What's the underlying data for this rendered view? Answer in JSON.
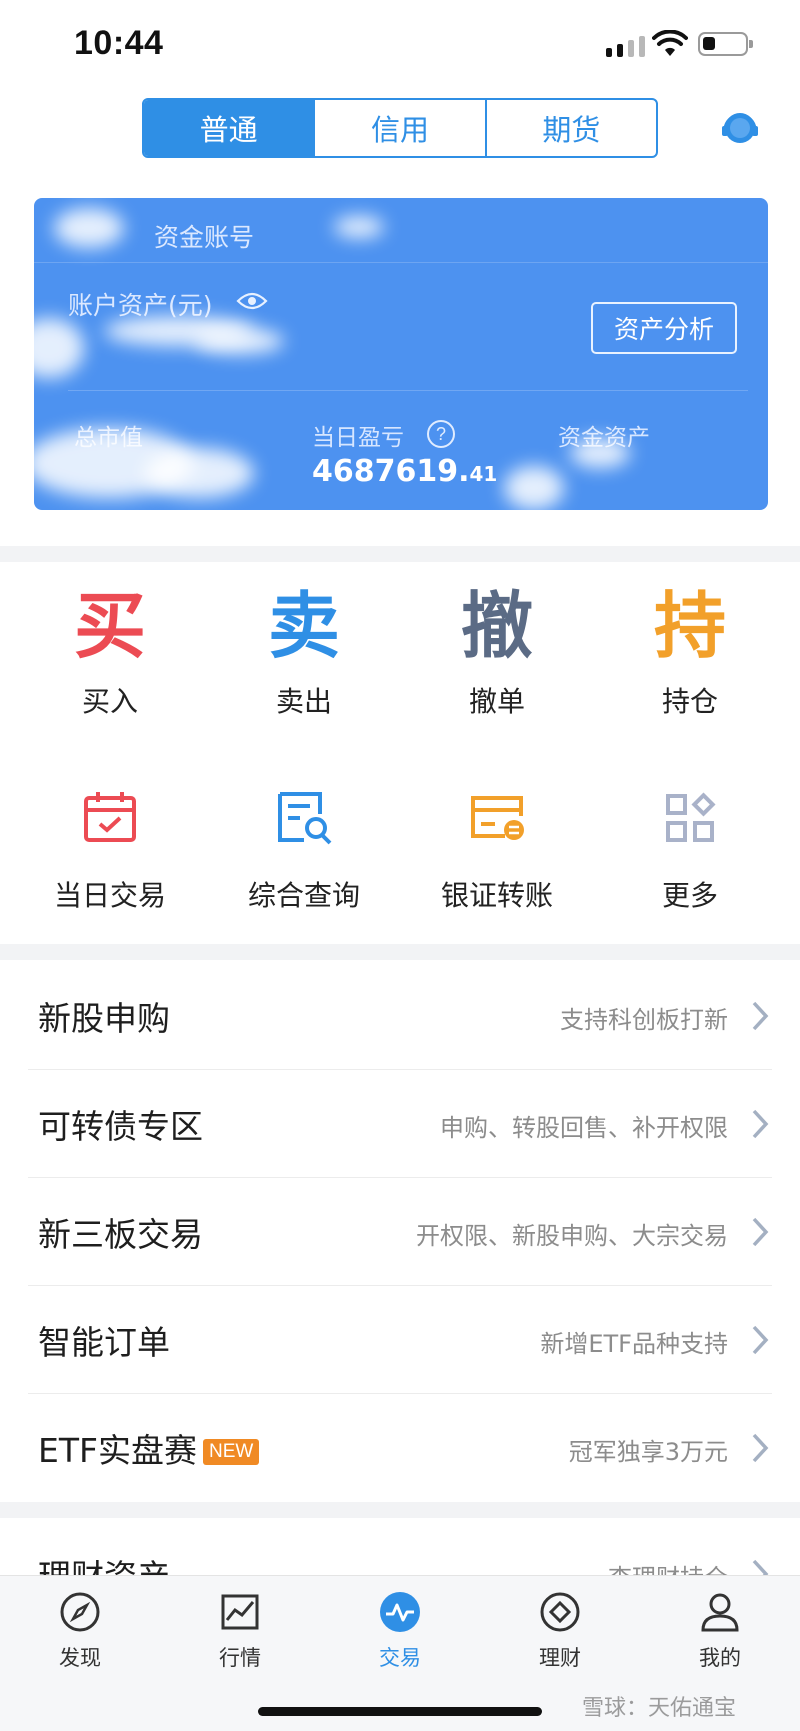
{
  "status_bar": {
    "time": "10:44"
  },
  "segments": [
    "普通",
    "信用",
    "期货"
  ],
  "account_card": {
    "account_label": "资金账号",
    "assets_label": "账户资产(元)",
    "analysis_button": "资产分析",
    "market_value_label": "总市值",
    "daily_pnl_label": "当日盈亏",
    "daily_pnl_int": "4687619.",
    "daily_pnl_dec": "41",
    "funds_label": "资金资产"
  },
  "primary_actions": [
    {
      "glyph": "买",
      "label": "买入",
      "color": "#ec4b53"
    },
    {
      "glyph": "卖",
      "label": "卖出",
      "color": "#2f8fe5"
    },
    {
      "glyph": "撤",
      "label": "撤单",
      "color": "#5b6b85"
    },
    {
      "glyph": "持",
      "label": "持仓",
      "color": "#f2a02a"
    }
  ],
  "secondary_actions": [
    {
      "label": "当日交易",
      "icon": "calendar-icon",
      "color": "#ec4b53"
    },
    {
      "label": "综合查询",
      "icon": "document-search-icon",
      "color": "#2f8fe5"
    },
    {
      "label": "银证转账",
      "icon": "bank-transfer-icon",
      "color": "#f2a02a"
    },
    {
      "label": "更多",
      "icon": "grid-more-icon",
      "color": "#a9b2c9"
    }
  ],
  "list_rows": [
    {
      "title": "新股申购",
      "subtitle": "支持科创板打新"
    },
    {
      "title": "可转债专区",
      "subtitle": "申购、转股回售、补开权限"
    },
    {
      "title": "新三板交易",
      "subtitle": "开权限、新股申购、大宗交易"
    },
    {
      "title": "智能订单",
      "subtitle": "新增ETF品种支持"
    },
    {
      "title": "ETF实盘赛",
      "badge": "NEW",
      "subtitle": "冠军独享3万元"
    },
    {
      "title": "理财资产",
      "subtitle": "查理财持仓"
    }
  ],
  "tabbar": [
    {
      "label": "发现",
      "icon": "compass-icon"
    },
    {
      "label": "行情",
      "icon": "chart-icon"
    },
    {
      "label": "交易",
      "icon": "trade-icon"
    },
    {
      "label": "理财",
      "icon": "wealth-icon"
    },
    {
      "label": "我的",
      "icon": "profile-icon"
    }
  ],
  "active_tab": "交易",
  "watermark": "雪球：天佑通宝",
  "colors": {
    "accent": "#2f8fe5",
    "card": "#4d92f0",
    "badge": "#f08a24"
  }
}
